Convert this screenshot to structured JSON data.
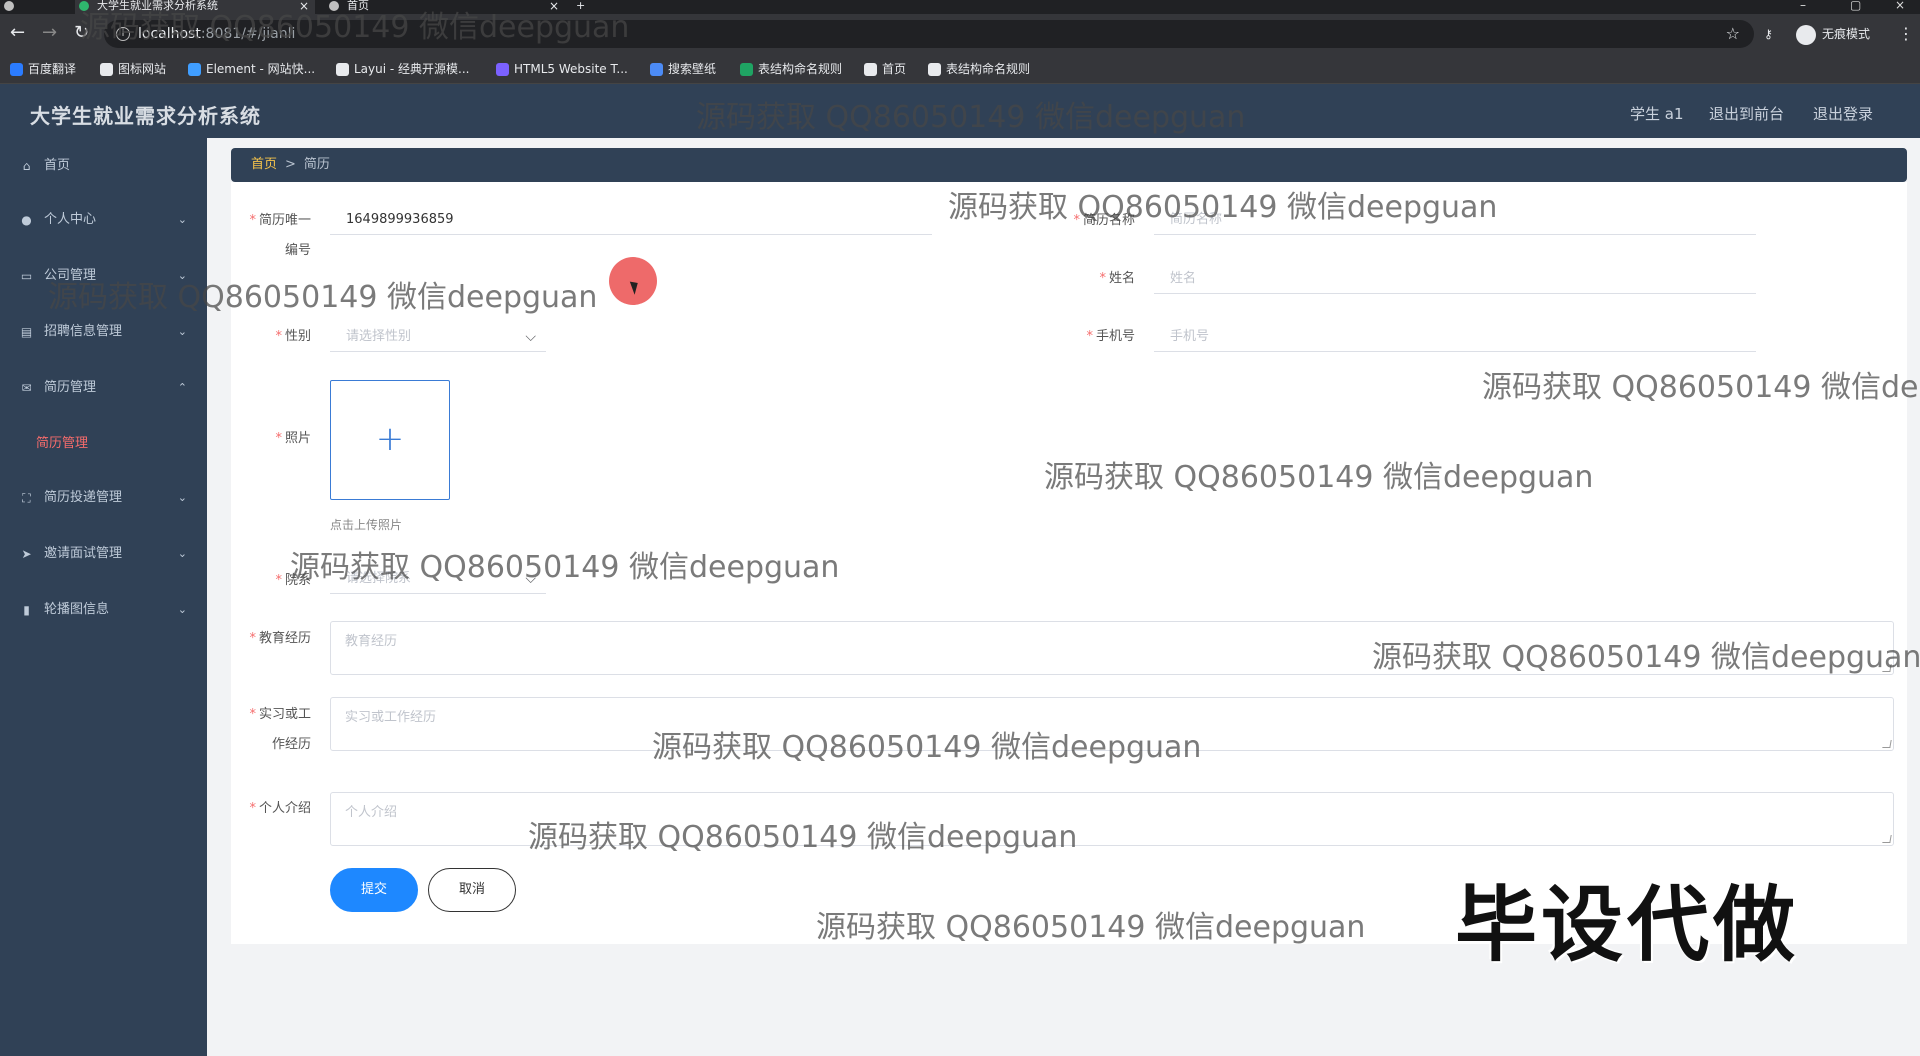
{
  "browser": {
    "tabs": [
      {
        "label": "大学生就业需求分析系统"
      },
      {
        "label": "首页"
      }
    ],
    "new_tab_label": "+",
    "url_host": "localhost",
    "url_rest": ":8081/#/jianli",
    "incognito_label": "无痕模式",
    "bookmarks": [
      {
        "label": "百度翻译",
        "color": "#2b7cff"
      },
      {
        "label": "图标网站",
        "color": "#e8eaed"
      },
      {
        "label": "Element - 网站快...",
        "color": "#409eff"
      },
      {
        "label": "Layui - 经典开源模...",
        "color": "#e8eaed"
      },
      {
        "label": "HTML5 Website T...",
        "color": "#7b61ff"
      },
      {
        "label": "搜索壁纸",
        "color": "#4c8bf5"
      },
      {
        "label": "表结构命名规则",
        "color": "#1fa463"
      },
      {
        "label": "首页",
        "color": "#e8eaed"
      },
      {
        "label": "表结构命名规则",
        "color": "#e8eaed"
      }
    ]
  },
  "header": {
    "title": "大学生就业需求分析系统",
    "user_label": "学生 a1",
    "front_link": "退出到前台",
    "logout_link": "退出登录"
  },
  "sidebar": {
    "items": [
      {
        "label": "首页",
        "icon": "home-icon",
        "glyph": "⌂",
        "chevron": ""
      },
      {
        "label": "个人中心",
        "icon": "user-icon",
        "glyph": "●",
        "chevron": "⌄"
      },
      {
        "label": "公司管理",
        "icon": "card-icon",
        "glyph": "▭",
        "chevron": "⌄"
      },
      {
        "label": "招聘信息管理",
        "icon": "doc-icon",
        "glyph": "▤",
        "chevron": "⌄"
      },
      {
        "label": "简历管理",
        "icon": "mail-icon",
        "glyph": "✉",
        "chevron": "⌃"
      },
      {
        "label": "简历管理",
        "sub": true
      },
      {
        "label": "简历投递管理",
        "icon": "frame-icon",
        "glyph": "⛶",
        "chevron": "⌄"
      },
      {
        "label": "邀请面试管理",
        "icon": "send-icon",
        "glyph": "➤",
        "chevron": "⌄"
      },
      {
        "label": "轮播图信息",
        "icon": "chart-icon",
        "glyph": "▮",
        "chevron": "⌄"
      }
    ]
  },
  "breadcrumb": {
    "home": "首页",
    "sep": ">",
    "current": "简历"
  },
  "form": {
    "resume_id_label_1": "简历唯一",
    "resume_id_label_2": "编号",
    "resume_id_value": "1649899936859",
    "resume_name_label": "简历名称",
    "resume_name_placeholder": "简历名称",
    "name_label": "姓名",
    "name_placeholder": "姓名",
    "gender_label": "性别",
    "gender_placeholder": "请选择性别",
    "phone_label": "手机号",
    "phone_placeholder": "手机号",
    "photo_label": "照片",
    "photo_plus": "+",
    "photo_hint": "点击上传照片",
    "college_label": "院系",
    "college_placeholder": "请选择院系",
    "education_label": "教育经历",
    "education_placeholder": "教育经历",
    "internship_label_1": "实习或工",
    "internship_label_2": "作经历",
    "internship_placeholder": "实习或工作经历",
    "intro_label": "个人介绍",
    "intro_placeholder": "个人介绍",
    "required_mark": "*",
    "submit_label": "提交",
    "cancel_label": "取消"
  },
  "overlay": {
    "watermark_text": "源码获取 QQ86050149 微信deepguan",
    "stamp_text": "毕设代做"
  }
}
